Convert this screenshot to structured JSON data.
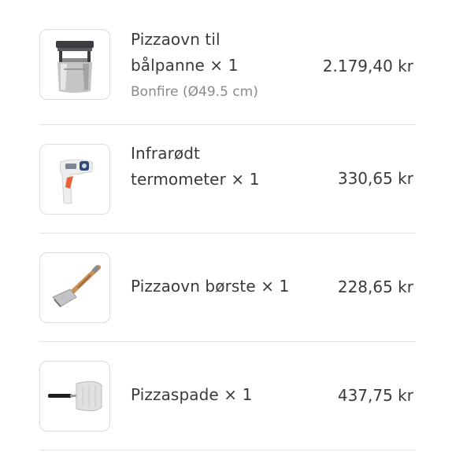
{
  "items": [
    {
      "title_line1": "Pizzaovn til",
      "title_line2": "bålpanne",
      "quantity": "× 1",
      "variant": "Bonfire (Ø49.5 cm)",
      "price": "2.179,40 kr",
      "icon": "pizza-oven-bonfire-image"
    },
    {
      "title_line1": "Infrarødt",
      "title_line2": "termometer",
      "quantity": "× 1",
      "price": "330,65 kr",
      "icon": "infrared-thermometer-image"
    },
    {
      "title": "Pizzaovn børste",
      "quantity": "× 1",
      "price": "228,65 kr",
      "icon": "oven-brush-image"
    },
    {
      "title": "Pizzaspade",
      "quantity": "× 1",
      "price": "437,75 kr",
      "icon": "pizza-peel-image"
    }
  ]
}
